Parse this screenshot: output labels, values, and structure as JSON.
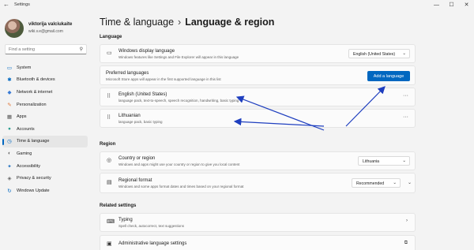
{
  "window": {
    "title": "Settings",
    "back_glyph": "←",
    "minimize_glyph": "—",
    "maximize_glyph": "☐",
    "close_glyph": "✕"
  },
  "profile": {
    "name": "viktorija valciukaite",
    "email": "wiki.v.e@gmail.com"
  },
  "search": {
    "placeholder": "Find a setting",
    "icon": "search-icon"
  },
  "nav": [
    {
      "label": "System",
      "icon": "system-icon",
      "glyph": "▭",
      "color": "#0067c0"
    },
    {
      "label": "Bluetooth & devices",
      "icon": "bluetooth-icon",
      "glyph": "✱",
      "color": "#0067c0"
    },
    {
      "label": "Network & internet",
      "icon": "network-icon",
      "glyph": "◆",
      "color": "#3a7bd5"
    },
    {
      "label": "Personalization",
      "icon": "personalization-icon",
      "glyph": "✎",
      "color": "#e0793a"
    },
    {
      "label": "Apps",
      "icon": "apps-icon",
      "glyph": "▦",
      "color": "#555555"
    },
    {
      "label": "Accounts",
      "icon": "accounts-icon",
      "glyph": "●",
      "color": "#2a9d8f"
    },
    {
      "label": "Time & language",
      "icon": "time-language-icon",
      "glyph": "◷",
      "color": "#0067c0",
      "active": true
    },
    {
      "label": "Gaming",
      "icon": "gaming-icon",
      "glyph": "◐",
      "color": "#666666"
    },
    {
      "label": "Accessibility",
      "icon": "accessibility-icon",
      "glyph": "✦",
      "color": "#1f6fbf"
    },
    {
      "label": "Privacy & security",
      "icon": "privacy-icon",
      "glyph": "◈",
      "color": "#666666"
    },
    {
      "label": "Windows Update",
      "icon": "windows-update-icon",
      "glyph": "↻",
      "color": "#0067c0"
    }
  ],
  "breadcrumb": {
    "parent": "Time & language",
    "separator": "›",
    "current": "Language & region"
  },
  "sections": {
    "language": "Language",
    "region": "Region",
    "related": "Related settings"
  },
  "language": {
    "display": {
      "title": "Windows display language",
      "subtitle": "Windows features like Settings and File Explorer will appear in this language",
      "value": "English (United States)",
      "icon": "monitor-icon"
    },
    "preferred": {
      "title": "Preferred languages",
      "subtitle": "Microsoft Store apps will appear in the first supported language in this list",
      "add_button": "Add a language"
    },
    "items": [
      {
        "title": "English (United States)",
        "subtitle": "language pack, text-to-speech, speech recognition, handwriting, basic typing"
      },
      {
        "title": "Lithuanian",
        "subtitle": "language pack, basic typing"
      }
    ],
    "more_glyph": "···",
    "drag_glyph": "⠿"
  },
  "region": {
    "country": {
      "title": "Country or region",
      "subtitle": "Windows and apps might use your country or region to give you local content",
      "value": "Lithuania",
      "icon": "globe-icon"
    },
    "format": {
      "title": "Regional format",
      "subtitle": "Windows and some apps format dates and times based on your regional format",
      "value": "Recommended",
      "icon": "calendar-icon"
    }
  },
  "related": {
    "typing": {
      "title": "Typing",
      "subtitle": "Spell check, autocorrect, text suggestions",
      "icon": "keyboard-icon"
    },
    "admin": {
      "title": "Administrative language settings",
      "icon": "language-settings-icon"
    }
  },
  "colors": {
    "accent": "#0067c0",
    "annotation": "#1f3fbf"
  }
}
